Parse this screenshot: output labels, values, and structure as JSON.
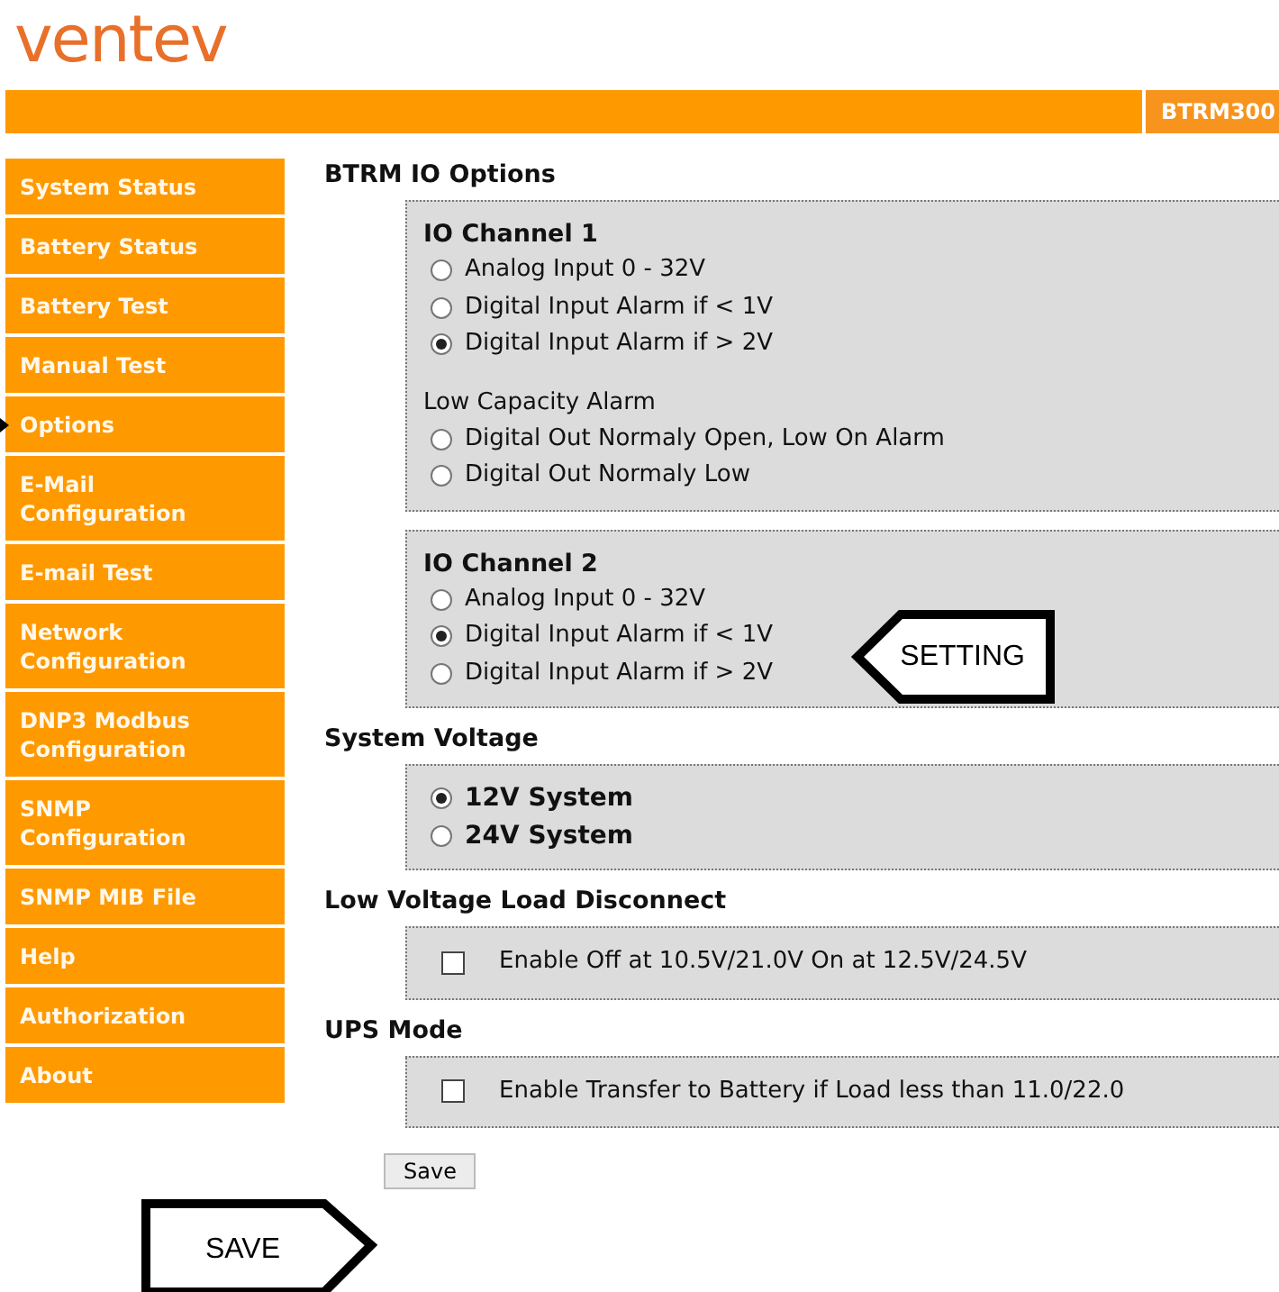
{
  "logo": "ventev",
  "header": {
    "badge": "BTRM300"
  },
  "sidebar": {
    "items": [
      {
        "label": "System Status",
        "selected": false
      },
      {
        "label": "Battery Status",
        "selected": false
      },
      {
        "label": "Battery Test",
        "selected": false
      },
      {
        "label": "Manual Test",
        "selected": false
      },
      {
        "label": "Options",
        "selected": true
      },
      {
        "label": "E-Mail\nConfiguration",
        "selected": false
      },
      {
        "label": "E-mail Test",
        "selected": false
      },
      {
        "label": "Network\nConfiguration",
        "selected": false
      },
      {
        "label": "DNP3 Modbus\nConfiguration",
        "selected": false
      },
      {
        "label": "SNMP\nConfiguration",
        "selected": false
      },
      {
        "label": "SNMP MIB File",
        "selected": false
      },
      {
        "label": "Help",
        "selected": false
      },
      {
        "label": "Authorization",
        "selected": false
      },
      {
        "label": "About",
        "selected": false
      }
    ]
  },
  "sections": [
    {
      "heading": "BTRM IO Options",
      "boxes": [
        {
          "kind": "plain",
          "groups": [
            {
              "title": "IO Channel 1",
              "options": [
                {
                  "kind": "radio",
                  "label": "Analog Input 0 - 32V",
                  "selected": false
                },
                {
                  "kind": "radio",
                  "label": "Digital Input Alarm if < 1V",
                  "selected": false
                },
                {
                  "kind": "radio",
                  "label": "Digital Input Alarm if > 2V",
                  "selected": true
                }
              ]
            },
            {
              "caption": "Low Capacity Alarm",
              "options": [
                {
                  "kind": "radio",
                  "label": "Digital Out Normaly Open, Low On Alarm",
                  "selected": false
                },
                {
                  "kind": "radio",
                  "label": "Digital Out Normaly Low",
                  "selected": false
                }
              ]
            }
          ]
        },
        {
          "kind": "plain",
          "groups": [
            {
              "title": "IO Channel 2",
              "options": [
                {
                  "kind": "radio",
                  "label": "Analog Input 0 - 32V",
                  "selected": false
                },
                {
                  "kind": "radio",
                  "label": "Digital Input Alarm if < 1V",
                  "selected": true
                },
                {
                  "kind": "radio",
                  "label": "Digital Input Alarm if > 2V",
                  "selected": false
                }
              ]
            }
          ]
        }
      ]
    },
    {
      "heading": "System Voltage",
      "boxes": [
        {
          "kind": "bold",
          "groups": [
            {
              "options": [
                {
                  "kind": "radio",
                  "label": "12V System",
                  "selected": true
                },
                {
                  "kind": "radio",
                  "label": "24V System",
                  "selected": false
                }
              ]
            }
          ]
        }
      ]
    },
    {
      "heading": "Low Voltage Load Disconnect",
      "boxes": [
        {
          "kind": "plain",
          "groups": [
            {
              "options": [
                {
                  "kind": "checkbox",
                  "label": "Enable Off at 10.5V/21.0V On at 12.5V/24.5V",
                  "checked": false
                }
              ]
            }
          ]
        }
      ]
    },
    {
      "heading": "UPS Mode",
      "boxes": [
        {
          "kind": "plain",
          "groups": [
            {
              "options": [
                {
                  "kind": "checkbox",
                  "label": "Enable Transfer to Battery if Load less than 11.0/22.0",
                  "checked": false
                }
              ]
            }
          ]
        }
      ]
    }
  ],
  "save_button": "Save",
  "callouts": [
    {
      "kind": "left",
      "text": "SETTING"
    },
    {
      "kind": "right",
      "text": "SAVE"
    }
  ]
}
